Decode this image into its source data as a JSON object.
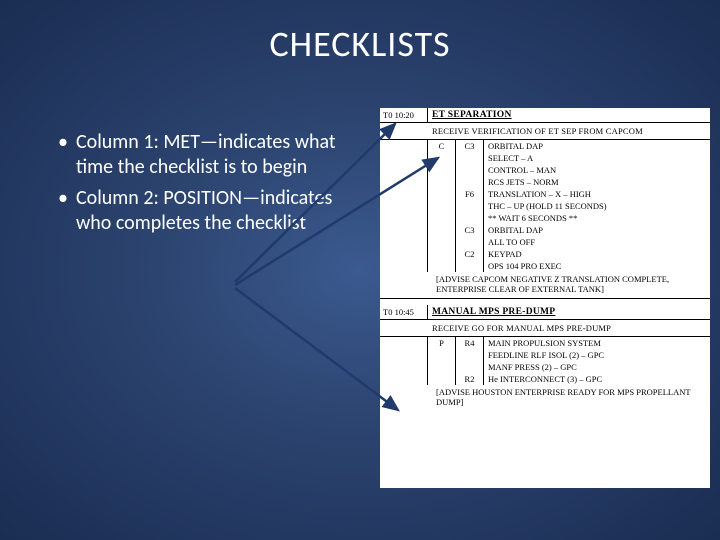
{
  "title": "CHECKLISTS",
  "bullets": {
    "b1": "Column 1: MET—indicates what time the checklist is to begin",
    "b2": "Column 2: POSITION—indicates who completes the checklist"
  },
  "checklist": {
    "sec1": {
      "met": "T0 10:20",
      "title": "ET SEPARATION",
      "note": "RECEIVE VERIFICATION OF ET SEP FROM CAPCOM",
      "rows": [
        {
          "c2": "C",
          "c3": "C3",
          "c4": "ORBITAL DAP"
        },
        {
          "c2": "",
          "c3": "",
          "c4": "SELECT – A"
        },
        {
          "c2": "",
          "c3": "",
          "c4": "CONTROL – MAN"
        },
        {
          "c2": "",
          "c3": "",
          "c4": "RCS JETS – NORM"
        },
        {
          "c2": "",
          "c3": "F6",
          "c4": "TRANSLATION – X – HIGH"
        },
        {
          "c2": "",
          "c3": "",
          "c4": "THC – UP (HOLD 11 SECONDS)"
        },
        {
          "c2": "",
          "c3": "",
          "c4": "** WAIT 6 SECONDS **"
        },
        {
          "c2": "",
          "c3": "C3",
          "c4": "ORBITAL DAP"
        },
        {
          "c2": "",
          "c3": "",
          "c4": "ALL TO OFF"
        },
        {
          "c2": "",
          "c3": "C2",
          "c4": "KEYPAD"
        },
        {
          "c2": "",
          "c3": "",
          "c4": "OPS 104 PRO EXEC"
        }
      ],
      "footnote": "[ADVISE CAPCOM NEGATIVE Z TRANSLATION COMPLETE, ENTERPRISE CLEAR OF EXTERNAL TANK]"
    },
    "sec2": {
      "met": "T0 10:45",
      "title": "MANUAL MPS PRE-DUMP",
      "note": "RECEIVE GO FOR MANUAL MPS PRE-DUMP",
      "rows": [
        {
          "c2": "P",
          "c3": "R4",
          "c4": "MAIN PROPULSION SYSTEM"
        },
        {
          "c2": "",
          "c3": "",
          "c4": "FEEDLINE RLF ISOL (2) – GPC"
        },
        {
          "c2": "",
          "c3": "",
          "c4": "MANF PRESS (2) – GPC"
        },
        {
          "c2": "",
          "c3": "R2",
          "c4": "He INTERCONNECT (3) – GPC"
        }
      ],
      "footnote": "[ADVISE HOUSTON ENTERPRISE READY FOR MPS PROPELLANT DUMP]"
    }
  }
}
